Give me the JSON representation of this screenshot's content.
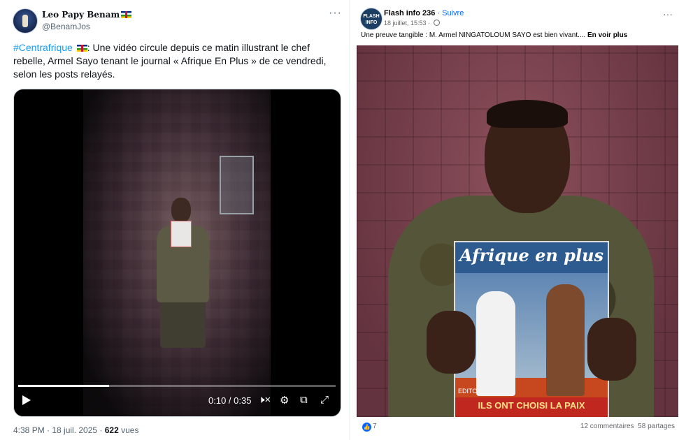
{
  "xpost": {
    "name": "Leo Papy Benam",
    "handle": "@BenamJos",
    "more": "···",
    "hashtag": "#Centrafrique",
    "text": ": Une vidéo circule depuis ce matin illustrant le chef rebelle, Armel Sayo tenant le journal « Afrique En Plus » de ce vendredi, selon les posts relayés.",
    "video": {
      "time": "0:10 / 0:35",
      "progress": 0.286,
      "mute_icon": "🕨×",
      "settings_icon": "⚙",
      "pip_icon": "⧉",
      "fullscreen_icon": "⤢"
    },
    "meta_time": "4:38 PM · 18 juil. 2025 · ",
    "views": "622",
    "views_label": " vues"
  },
  "fbpost": {
    "page_name": "Flash info 236",
    "follow": " · Suivre",
    "date": "18 juillet, 15:53 · ",
    "more": "···",
    "avatar_text": "FLASH INFO",
    "text": "Une preuve tangible : M. Armel NINGATOLOUM SAYO est bien vivant.... ",
    "see_more": "En voir plus",
    "magazine_title": "Afrique en plus",
    "magazine_sub": "EDITO",
    "magazine_bottom": "ILS ONT CHOISI LA PAIX",
    "likes": "7",
    "comments": "12 commentaires",
    "shares": "58 partages"
  }
}
